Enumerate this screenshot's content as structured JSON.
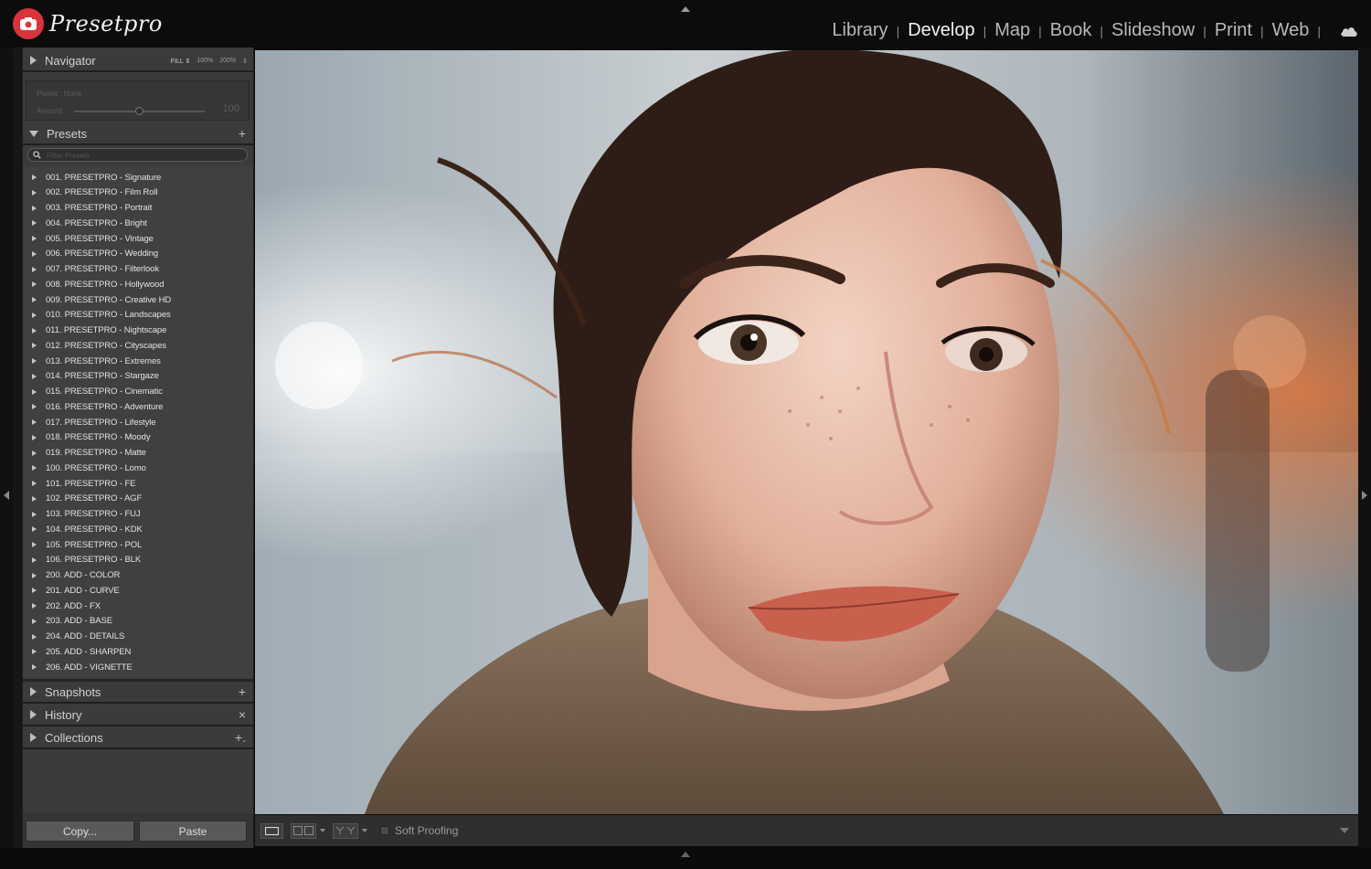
{
  "app": {
    "brand": "Presetpro"
  },
  "modules": [
    "Library",
    "Develop",
    "Map",
    "Book",
    "Slideshow",
    "Print",
    "Web"
  ],
  "active_module": "Develop",
  "navigator": {
    "title": "Navigator",
    "zooms": [
      "FILL ⇕",
      "100%",
      "200%",
      "⇕"
    ]
  },
  "preset_amount": {
    "preset_label": "Preset : None",
    "amount_label": "Amount",
    "amount_value": "100",
    "amount_fraction": 0.5
  },
  "presets": {
    "title": "Presets",
    "add": "+",
    "filter_placeholder": "Filter Presets",
    "items": [
      "001. PRESETPRO - Signature",
      "002. PRESETPRO - Film Roll",
      "003. PRESETPRO - Portrait",
      "004. PRESETPRO - Bright",
      "005. PRESETPRO - Vintage",
      "006. PRESETPRO - Wedding",
      "007. PRESETPRO - Filterlook",
      "008. PRESETPRO - Hollywood",
      "009. PRESETPRO - Creative HD",
      "010. PRESETPRO - Landscapes",
      "011. PRESETPRO - Nightscape",
      "012. PRESETPRO - Cityscapes",
      "013. PRESETPRO - Extremes",
      "014. PRESETPRO - Stargaze",
      "015. PRESETPRO - Cinematic",
      "016. PRESETPRO - Adventure",
      "017. PRESETPRO - Lifestyle",
      "018. PRESETPRO - Moody",
      "019. PRESETPRO - Matte",
      "100. PRESETPRO - Lomo",
      "101. PRESETPRO - FE",
      "102. PRESETPRO - AGF",
      "103. PRESETPRO - FUJ",
      "104. PRESETPRO - KDK",
      "105. PRESETPRO - POL",
      "106. PRESETPRO - BLK",
      "200. ADD - COLOR",
      "201. ADD - CURVE",
      "202. ADD - FX",
      "203. ADD - BASE",
      "204. ADD - DETAILS",
      "205. ADD - SHARPEN",
      "206. ADD - VIGNETTE"
    ]
  },
  "snapshots": {
    "title": "Snapshots",
    "action": "+"
  },
  "history": {
    "title": "History",
    "action": "×"
  },
  "collections": {
    "title": "Collections",
    "action": "+."
  },
  "buttons": {
    "copy": "Copy...",
    "paste": "Paste"
  },
  "toolbar": {
    "soft_proofing": "Soft Proofing"
  },
  "colors": {
    "accent": "#d8343c",
    "panel": "#3b3b3b",
    "list_bg": "#404040",
    "top_bar": "#0c0c0c"
  },
  "icons": [
    "camera-icon",
    "cloud-icon",
    "search-icon",
    "loupe-view-icon",
    "before-after-icon",
    "compare-icon"
  ]
}
